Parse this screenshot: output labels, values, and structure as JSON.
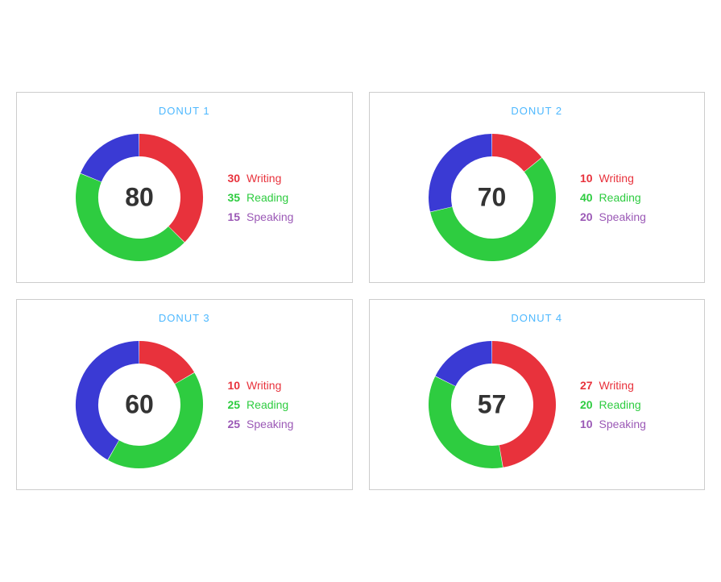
{
  "donuts": [
    {
      "id": "donut1",
      "title": "DONUT 1",
      "center": "80",
      "segments": [
        {
          "label": "Writing",
          "value": 30,
          "color": "#e8323c"
        },
        {
          "label": "Reading",
          "value": 35,
          "color": "#2ecc40"
        },
        {
          "label": "Speaking",
          "value": 15,
          "color": "#3a3ad4"
        }
      ]
    },
    {
      "id": "donut2",
      "title": "DONUT 2",
      "center": "70",
      "segments": [
        {
          "label": "Writing",
          "value": 10,
          "color": "#e8323c"
        },
        {
          "label": "Reading",
          "value": 40,
          "color": "#2ecc40"
        },
        {
          "label": "Speaking",
          "value": 20,
          "color": "#3a3ad4"
        }
      ]
    },
    {
      "id": "donut3",
      "title": "DONUT 3",
      "center": "60",
      "segments": [
        {
          "label": "Writing",
          "value": 10,
          "color": "#e8323c"
        },
        {
          "label": "Reading",
          "value": 25,
          "color": "#2ecc40"
        },
        {
          "label": "Speaking",
          "value": 25,
          "color": "#3a3ad4"
        }
      ]
    },
    {
      "id": "donut4",
      "title": "DONUT 4",
      "center": "57",
      "segments": [
        {
          "label": "Writing",
          "value": 27,
          "color": "#e8323c"
        },
        {
          "label": "Reading",
          "value": 20,
          "color": "#2ecc40"
        },
        {
          "label": "Speaking",
          "value": 10,
          "color": "#3a3ad4"
        }
      ]
    }
  ],
  "legend_colors": {
    "Writing": "#e8323c",
    "Reading": "#2ecc40",
    "Speaking": "#9b59b6"
  }
}
